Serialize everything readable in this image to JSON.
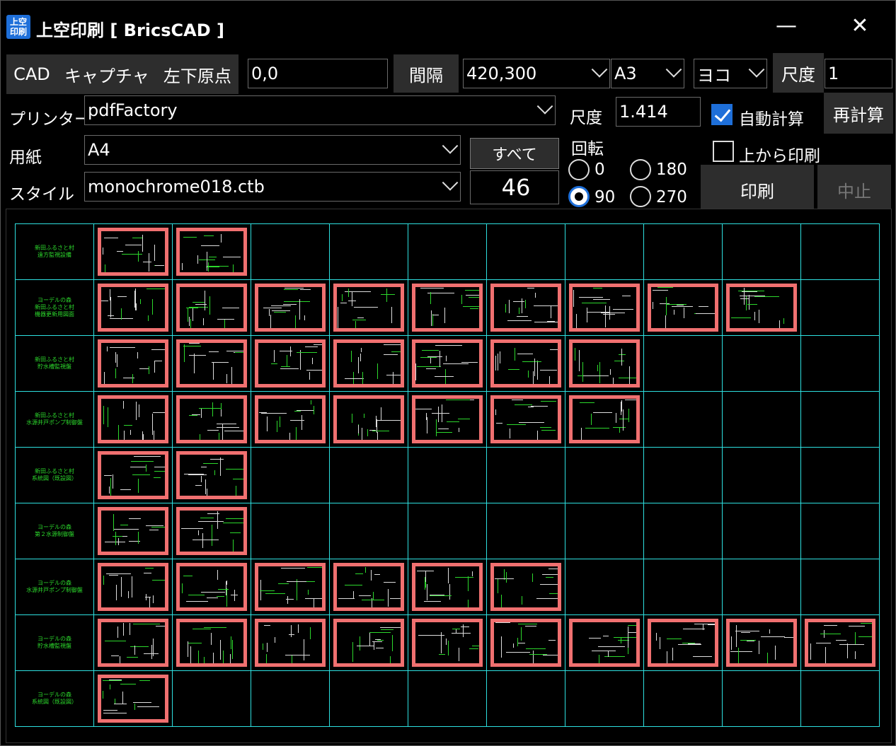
{
  "window": {
    "title": "上空印刷 [ BricsCAD ]",
    "app_icon_text": "上空印刷",
    "minimize": "—",
    "close": "✕"
  },
  "toolbar": {
    "cad": "CAD",
    "capture": "キャプチャ",
    "origin": "左下原点",
    "origin_value": "0,0",
    "spacing_button": "間隔",
    "spacing_value": "420,300",
    "paper_size": "A3",
    "orientation": "ヨコ",
    "scale_label": "尺度",
    "scale_value": "1"
  },
  "printer": {
    "label": "プリンター",
    "value": "pdfFactory"
  },
  "scale2": {
    "label": "尺度",
    "value": "1.414"
  },
  "auto_calc": {
    "label": "自動計算",
    "checked": true
  },
  "recalc": "再計算",
  "paper": {
    "label": "用紙",
    "value": "A4"
  },
  "all_button": "すべて",
  "count": "46",
  "rotation": {
    "label": "回転",
    "options": [
      "0",
      "180",
      "90",
      "270"
    ],
    "selected": "90"
  },
  "top_print": {
    "label": "上から印刷",
    "checked": false
  },
  "style": {
    "label": "スタイル",
    "value": "monochrome018.ctb"
  },
  "print_button": "印刷",
  "stop_button": "中止",
  "rows": [
    {
      "label": "新田ふるさと村\n遠方監視設備",
      "thumbs": 2
    },
    {
      "label": "ヨーデルの森\n新田ふるさと村\n機器更新用図面",
      "thumbs": 9
    },
    {
      "label": "新田ふるさと村\n貯水槽監視盤",
      "thumbs": 7
    },
    {
      "label": "新田ふるさと村\n水源井戸ポンプ制御盤",
      "thumbs": 7
    },
    {
      "label": "新田ふるさと村\n系統図（既設図）",
      "thumbs": 2
    },
    {
      "label": "ヨーデルの森\n第２水源制御盤",
      "thumbs": 2
    },
    {
      "label": "ヨーデルの森\n水源井戸ポンプ制御盤",
      "thumbs": 6
    },
    {
      "label": "ヨーデルの森\n貯水槽監視盤",
      "thumbs": 10
    },
    {
      "label": "ヨーデルの森\n系統図（既設図）",
      "thumbs": 1
    }
  ]
}
